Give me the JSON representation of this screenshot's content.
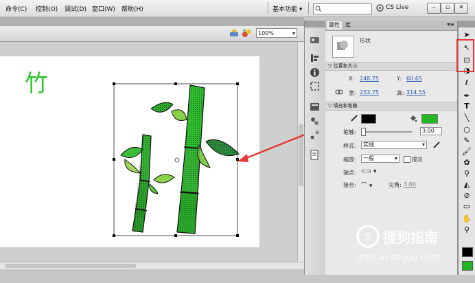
{
  "menubar": {
    "items": [
      "命令(C)",
      "控制(O)",
      "调试(D)",
      "窗口(W)",
      "帮助(H)"
    ],
    "workspace": "基本功能 ▾",
    "cs_live": "CS Live"
  },
  "editbar": {
    "zoom": "100%"
  },
  "stage": {
    "caption": "竹"
  },
  "panel": {
    "tabs": [
      "属性",
      "库"
    ],
    "object_type": "形状",
    "section_position": "位置和大小",
    "x_label": "X:",
    "x_value": "248.75",
    "y_label": "Y:",
    "y_value": "60.65",
    "w_label": "宽:",
    "w_value": "253.75",
    "h_label": "高:",
    "h_value": "314.55",
    "section_fill": "填充和笔触",
    "stroke_label": "笔触:",
    "stroke_value": "3.00",
    "style_label": "样式:",
    "style_value": "实线",
    "scale_label": "缩放:",
    "scale_value": "一般",
    "hint_label": "提示",
    "cap_label": "端点:",
    "join_label": "接合:",
    "miter_label": "尖角:",
    "miter_value": "3.00",
    "stroke_color": "#000000",
    "fill_color": "#22b622"
  },
  "watermark": {
    "brand": "搜狗指南",
    "url": "zhinan.sogou.com"
  },
  "colors": {
    "accent": "#e53935",
    "bamboo": "#22b622"
  }
}
